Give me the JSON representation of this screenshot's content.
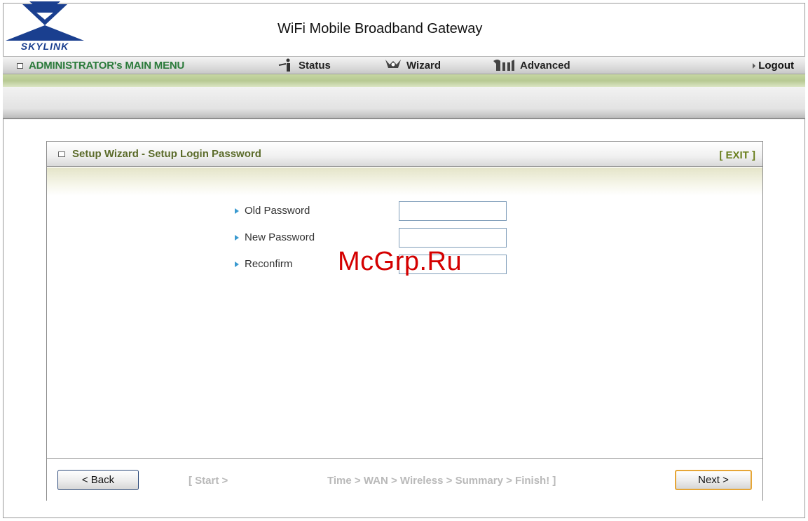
{
  "header": {
    "logo_text": "SKYLINK",
    "title": "WiFi Mobile Broadband Gateway"
  },
  "menu": {
    "home_label": "ADMINISTRATOR's MAIN MENU",
    "items": [
      {
        "label": "Status",
        "icon": "status-icon"
      },
      {
        "label": "Wizard",
        "icon": "wizard-icon"
      },
      {
        "label": "Advanced",
        "icon": "advanced-icon"
      }
    ],
    "logout_label": "Logout"
  },
  "panel": {
    "title": "Setup Wizard - Setup Login Password",
    "exit_label": "[ EXIT ]",
    "fields": [
      {
        "label": "Old Password",
        "value": ""
      },
      {
        "label": "New Password",
        "value": ""
      },
      {
        "label": "Reconfirm",
        "value": ""
      }
    ]
  },
  "footer": {
    "back_label": "< Back",
    "steps_start": "[ Start >",
    "steps_rest": "Time > WAN > Wireless > Summary > Finish! ]",
    "next_label": "Next >"
  },
  "watermark": "McGrp.Ru",
  "colors": {
    "menu_home": "#2a7a3a",
    "panel_title": "#5b6b2a",
    "logo": "#1a3f8f",
    "watermark": "#d40000"
  }
}
